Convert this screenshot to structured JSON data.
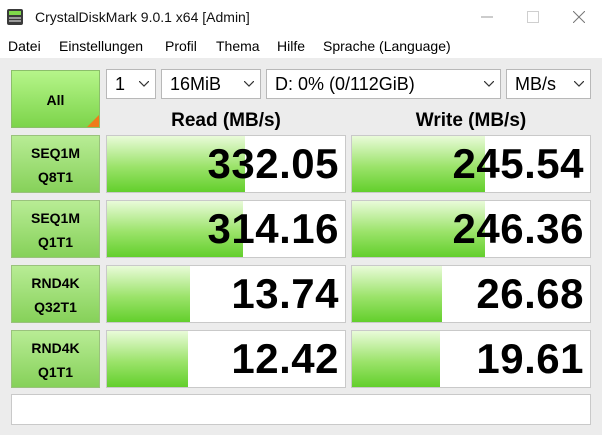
{
  "window": {
    "title": "CrystalDiskMark 9.0.1 x64 [Admin]"
  },
  "menu": [
    "Datei",
    "Einstellungen",
    "Profil",
    "Thema",
    "Hilfe",
    "Sprache (Language)"
  ],
  "controls": {
    "all_label": "All",
    "count": "1",
    "size": "16MiB",
    "drive": "D: 0% (0/112GiB)",
    "unit": "MB/s"
  },
  "columns": {
    "read": "Read (MB/s)",
    "write": "Write (MB/s)"
  },
  "tests": [
    {
      "line1": "SEQ1M",
      "line2": "Q8T1",
      "read": "332.05",
      "write": "245.54",
      "read_fill": 0.58,
      "write_fill": 0.56
    },
    {
      "line1": "SEQ1M",
      "line2": "Q1T1",
      "read": "314.16",
      "write": "246.36",
      "read_fill": 0.57,
      "write_fill": 0.56
    },
    {
      "line1": "RND4K",
      "line2": "Q32T1",
      "read": "13.74",
      "write": "26.68",
      "read_fill": 0.35,
      "write_fill": 0.38
    },
    {
      "line1": "RND4K",
      "line2": "Q1T1",
      "read": "12.42",
      "write": "19.61",
      "read_fill": 0.34,
      "write_fill": 0.37
    }
  ],
  "comment": "",
  "colors": {
    "accent_green": "#7cd44a",
    "corner_orange": "#f07b1a"
  }
}
